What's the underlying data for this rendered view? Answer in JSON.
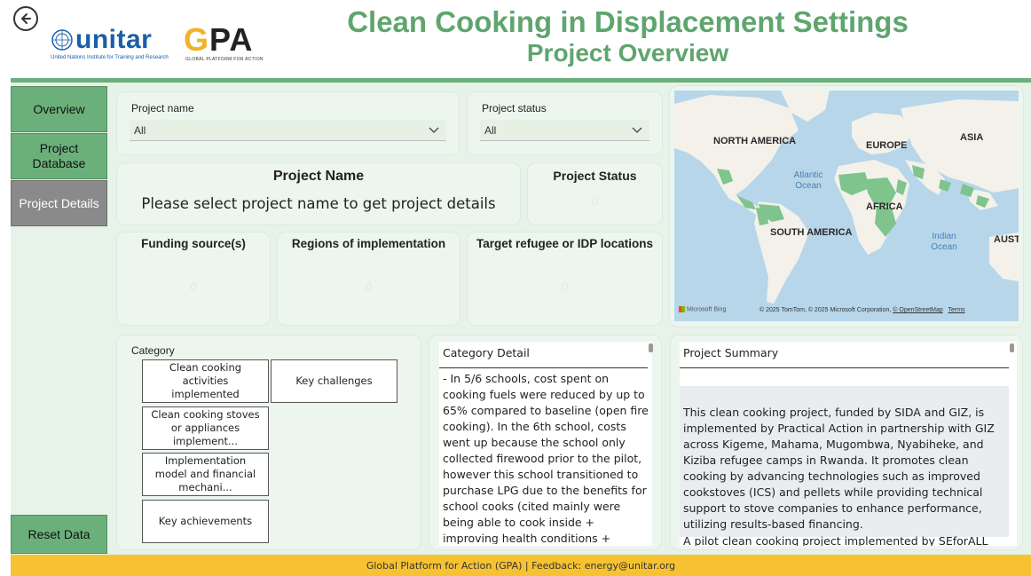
{
  "header": {
    "title": "Clean Cooking in Displacement Settings",
    "subtitle": "Project Overview",
    "unitar_logo_text": "unitar",
    "unitar_tagline": "United Nations Institute for Training and Research",
    "gpa_logo_text": "GPA",
    "gpa_tagline": "GLOBAL PLATFORM FOR ACTION",
    "back_icon": "back-arrow-icon"
  },
  "nav": {
    "overview": "Overview",
    "project_database": "Project Database",
    "project_details": "Project Details",
    "reset_data": "Reset Data"
  },
  "filters": {
    "project_name_label": "Project name",
    "project_name_value": "All",
    "project_status_label": "Project status",
    "project_status_value": "All"
  },
  "cards": {
    "project_name_title": "Project Name",
    "project_name_message": "Please select project name to get project details",
    "project_status_title": "Project Status",
    "project_status_value": "0",
    "funding_title": "Funding source(s)",
    "funding_value": "0",
    "regions_title": "Regions of implementation",
    "regions_value": "0",
    "locations_title": "Target refugee or IDP locations",
    "locations_value": "0"
  },
  "map": {
    "labels": [
      "NORTH AMERICA",
      "EUROPE",
      "ASIA",
      "AFRICA",
      "SOUTH AMERICA",
      "AUSTI"
    ],
    "oceans": [
      "Atlantic Ocean",
      "Indian Ocean"
    ],
    "bing": "Microsoft Bing",
    "credit": "© 2025 TomTom, © 2025 Microsoft Corporation,",
    "credit_osm": "© OpenStreetMap",
    "credit_terms": "Terms",
    "colors": {
      "water": "#b7d6ea",
      "land": "#f3f1ea",
      "highlight": "#7fc48c"
    }
  },
  "category": {
    "label": "Category",
    "buttons": [
      "Clean cooking activities implemented",
      "Key challenges",
      "Clean cooking stoves or appliances implement...",
      "Implementation model and financial mechani...",
      "Key achievements"
    ]
  },
  "category_detail": {
    "title": "Category Detail",
    "text": "- In 5/6 schools, cost spent on cooking fuels were reduced by up to 65% compared to baseline (open fire cooking). In the 6th school, costs went up because the school only collected firewood prior to the pilot, however this school transitioned to purchase LPG due to the benefits for school cooks (cited mainly were being able to cook inside + improving health conditions + efficiency of cooking with"
  },
  "project_summary": {
    "title": "Project Summary",
    "text": "This clean cooking project, funded by SIDA and GIZ, is implemented by Practical Action in partnership with GIZ across Kigeme, Mahama, Mugombwa, Nyabiheke, and Kiziba refugee camps in Rwanda. It promotes clean cooking by advancing technologies such as improved cookstoves (ICS) and pellets while providing technical support to stove companies to enhance performance, utilizing results-based financing.",
    "text2": "A pilot clean cooking project implemented by SEforALL and"
  },
  "footer": {
    "text": "Global Platform for Action (GPA) | Feedback: energy@unitar.org"
  },
  "colors": {
    "accent_green": "#6bb07a",
    "title_green": "#5fa56e",
    "panel_bg": "#e7f2e8",
    "footer_yellow": "#f6c232",
    "active_nav": "#8a8a8a"
  }
}
